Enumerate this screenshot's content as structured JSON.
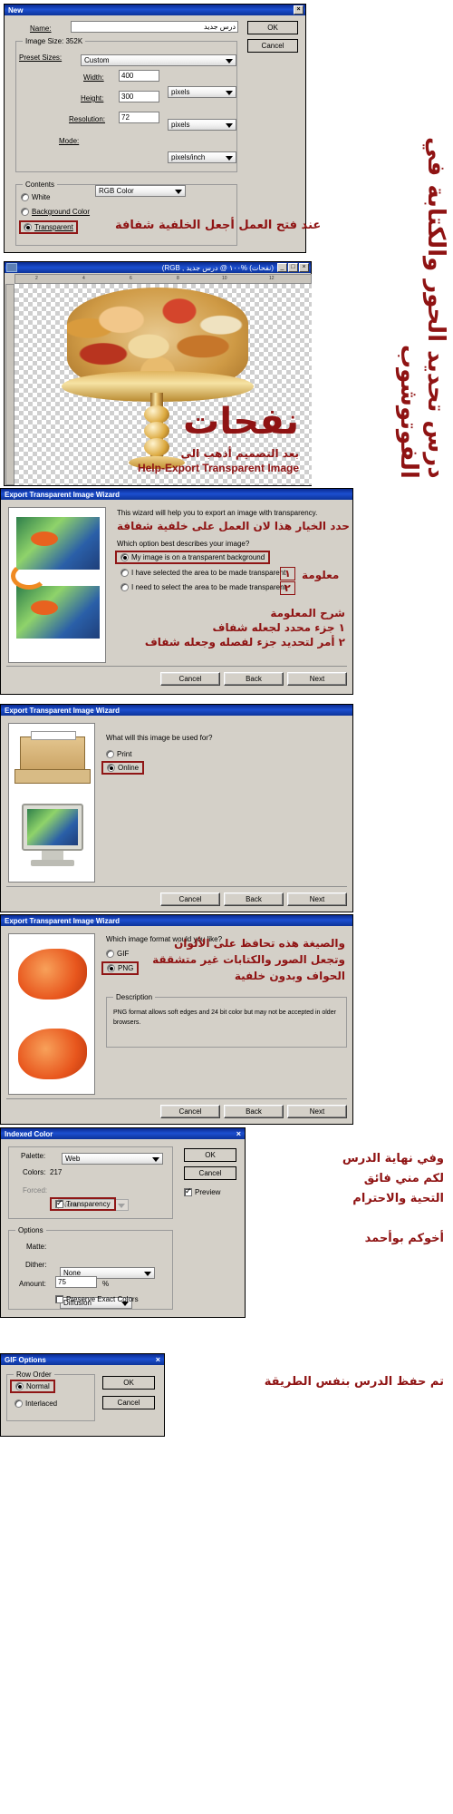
{
  "new_dialog": {
    "title": "New",
    "name_label": "Name:",
    "name_value": "درس جديد",
    "image_size_group": "Image Size: 352K",
    "preset_label": "Preset Sizes:",
    "preset_value": "Custom",
    "width_label": "Width:",
    "width_value": "400",
    "width_unit": "pixels",
    "height_label": "Height:",
    "height_value": "300",
    "height_unit": "pixels",
    "resolution_label": "Resolution:",
    "resolution_value": "72",
    "resolution_unit": "pixels/inch",
    "mode_label": "Mode:",
    "mode_value": "RGB Color",
    "contents_group": "Contents",
    "contents_options": [
      "White",
      "Background Color",
      "Transparent"
    ],
    "contents_selected": "Transparent",
    "ok": "OK",
    "cancel": "Cancel",
    "annotation": "عند فتح العمل أجعل الخلفية شفافة"
  },
  "ps_window": {
    "title": "(نفحات) %١٠٠ @ درس جديد , RGB)",
    "minimize": "_",
    "maximize": "□",
    "close": "×",
    "ruler_marks": [
      "2",
      "4",
      "6",
      "8",
      "10",
      "12"
    ],
    "watermark_main": "نفحات",
    "watermark_sub": "بعد التصميم أذهب الى",
    "watermark_en": "Help-Export  Transparent  Image"
  },
  "wizard1": {
    "title": "Export Transparent Image Wizard",
    "intro": "This wizard will help you to export an image with transparency.",
    "question": "Which option best describes your image?",
    "options": [
      "My image is on a transparent background",
      "I have selected the area to be made transparent",
      "I need to select the area to be made transparent"
    ],
    "selected_index": 0,
    "cancel": "Cancel",
    "back": "Back",
    "next": "Next",
    "annotation_top": "حدد الخيار هذا لان العمل على خلفية شفافة",
    "annotation_info": "معلومة",
    "badge_1": "١",
    "badge_2": "٢",
    "annotation_line1": "شرح المعلومة",
    "annotation_line2": "١   جزء محدد لجعله شفاف",
    "annotation_line3": "٢   أمر لتحديد جزء لفصله وجعله شفاف"
  },
  "wizard2": {
    "title": "Export Transparent Image Wizard",
    "question": "What will this image be used for?",
    "options": [
      "Print",
      "Online"
    ],
    "selected_index": 1,
    "cancel": "Cancel",
    "back": "Back",
    "next": "Next"
  },
  "wizard3": {
    "title": "Export Transparent Image Wizard",
    "question": "Which image format would you like?",
    "options": [
      "GIF",
      "PNG"
    ],
    "selected_index": 1,
    "desc_group": "Description",
    "desc_text": "PNG format allows soft edges and 24 bit color but may not be accepted in older browsers.",
    "cancel": "Cancel",
    "back": "Back",
    "next": "Next",
    "annotation_line1": "والصيغة هذه تحافظ على الألوان",
    "annotation_line2": "وتجعل الصور والكتابات غير متشققة",
    "annotation_line3": "الحواف وبدون خلفية"
  },
  "indexed_color": {
    "title": "Indexed Color",
    "close": "×",
    "palette_label": "Palette:",
    "palette_value": "Web",
    "colors_label": "Colors:",
    "colors_value": "217",
    "forced_label": "Forced:",
    "forced_value": "None",
    "transparency_label": "Transparency",
    "transparency_checked": true,
    "options_group": "Options",
    "matte_label": "Matte:",
    "matte_value": "None",
    "dither_label": "Dither:",
    "dither_value": "Diffusion",
    "amount_label": "Amount:",
    "amount_value": "75",
    "amount_unit": "%",
    "preserve_label": "Preserve Exact Colors",
    "preserve_checked": false,
    "ok": "OK",
    "cancel": "Cancel",
    "preview_label": "Preview",
    "preview_checked": true,
    "annotation_line1": "وفي نهاية الدرس",
    "annotation_line2": "لكم مني فائق",
    "annotation_line3": "التحية والاحترام",
    "annotation_line4": "أخوكم بوأحمد"
  },
  "gif_options": {
    "title": "GIF Options",
    "close": "×",
    "group": "Row Order",
    "options": [
      "Normal",
      "Interlaced"
    ],
    "selected_index": 0,
    "ok": "OK",
    "cancel": "Cancel",
    "annotation": "تم حفظ الدرس بنفس الطريقة"
  },
  "side_banner": {
    "text": "درس تحديد الحور والكتابة في الفوتوشوب"
  },
  "colors": {
    "accent_red": "#8f1313",
    "title_blue": "#0c3399",
    "dialog_face": "#d4d0c8"
  }
}
